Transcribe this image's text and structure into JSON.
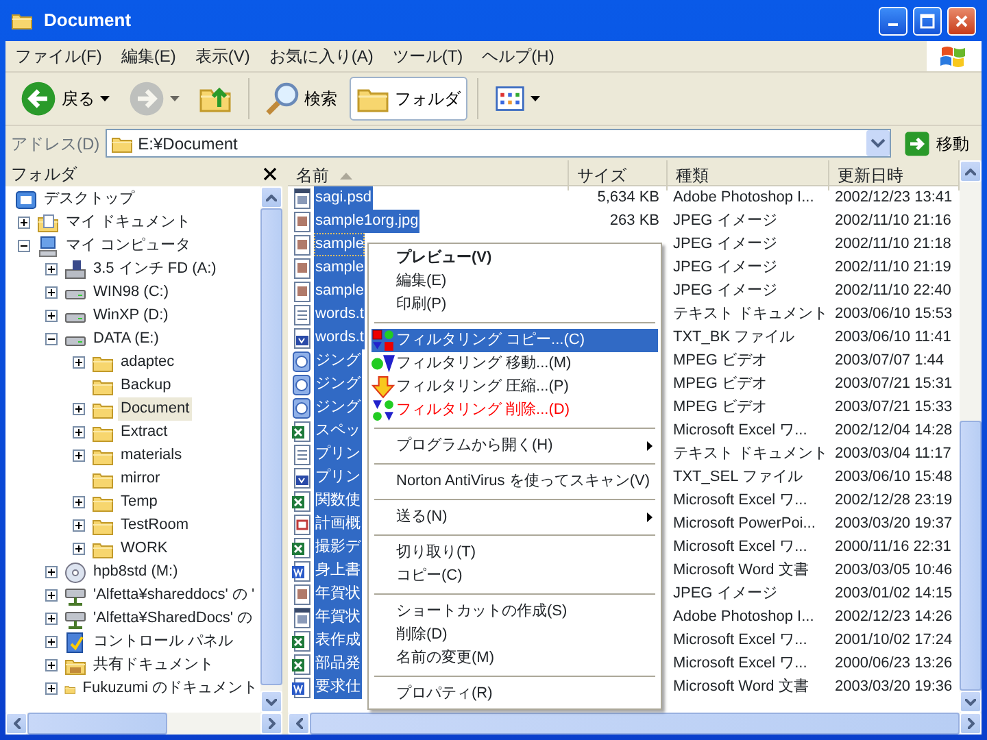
{
  "window": {
    "title": "Document"
  },
  "menu_bar": [
    "ファイル(F)",
    "編集(E)",
    "表示(V)",
    "お気に入り(A)",
    "ツール(T)",
    "ヘルプ(H)"
  ],
  "toolbar": [
    {
      "kind": "back",
      "label": "戻る",
      "disabled": false
    },
    {
      "kind": "forward",
      "disabled": true
    },
    {
      "kind": "up",
      "disabled": false
    },
    {
      "kind": "separator"
    },
    {
      "kind": "search",
      "label": "検索",
      "pressed": false
    },
    {
      "kind": "folders",
      "label": "フォルダ",
      "pressed": true
    },
    {
      "kind": "separator"
    },
    {
      "kind": "views"
    }
  ],
  "address_bar": {
    "label": "アドレス(D)",
    "value": "E:¥Document",
    "go_label": "移動"
  },
  "folder_pane": {
    "title": "フォルダ",
    "tree": [
      {
        "label": "デスクトップ",
        "kind": "desktop",
        "selected": false,
        "children": [
          {
            "label": "マイ ドキュメント",
            "kind": "mydocs",
            "expanded": false,
            "selected": false
          },
          {
            "label": "マイ コンピュータ",
            "kind": "computer",
            "expanded": true,
            "selected": false,
            "children": [
              {
                "label": "3.5 インチ FD (A:)",
                "kind": "floppy",
                "expanded": false,
                "selected": false
              },
              {
                "label": "WIN98 (C:)",
                "kind": "drive",
                "expanded": false,
                "selected": false
              },
              {
                "label": "WinXP (D:)",
                "kind": "drive",
                "expanded": false,
                "selected": false
              },
              {
                "label": "DATA (E:)",
                "kind": "drive",
                "expanded": true,
                "selected": false,
                "children": [
                  {
                    "label": "adaptec",
                    "kind": "folder",
                    "expanded": false,
                    "selected": false
                  },
                  {
                    "label": "Backup",
                    "kind": "folder",
                    "selected": false
                  },
                  {
                    "label": "Document",
                    "kind": "folder",
                    "expanded": false,
                    "selected": true
                  },
                  {
                    "label": "Extract",
                    "kind": "folder",
                    "expanded": false,
                    "selected": false
                  },
                  {
                    "label": "materials",
                    "kind": "folder",
                    "expanded": false,
                    "selected": false
                  },
                  {
                    "label": "mirror",
                    "kind": "folder",
                    "selected": false
                  },
                  {
                    "label": "Temp",
                    "kind": "folder",
                    "expanded": false,
                    "selected": false
                  },
                  {
                    "label": "TestRoom",
                    "kind": "folder",
                    "expanded": false,
                    "selected": false
                  },
                  {
                    "label": "WORK",
                    "kind": "folder",
                    "expanded": false,
                    "selected": false
                  }
                ]
              },
              {
                "label": "hpb8std (M:)",
                "kind": "cd",
                "expanded": false,
                "selected": false
              },
              {
                "label": "'Alfetta¥shareddocs' の '",
                "kind": "netdrive",
                "expanded": false,
                "selected": false
              },
              {
                "label": "'Alfetta¥SharedDocs' の",
                "kind": "netdrive",
                "expanded": false,
                "selected": false
              },
              {
                "label": "コントロール パネル",
                "kind": "control",
                "expanded": false,
                "selected": false
              },
              {
                "label": "共有ドキュメント",
                "kind": "shared",
                "expanded": false,
                "selected": false
              },
              {
                "label": "Fukuzumi のドキュメント",
                "kind": "folder",
                "expanded": false,
                "selected": false
              }
            ]
          }
        ]
      }
    ]
  },
  "file_list": {
    "columns": [
      {
        "label": "名前",
        "sorted": true
      },
      {
        "label": "サイズ",
        "sorted": false
      },
      {
        "label": "種類",
        "sorted": false
      },
      {
        "label": "更新日時",
        "sorted": false
      }
    ],
    "rows": [
      {
        "kind": "psd",
        "name": "sagi.psd",
        "size": "5,634 KB",
        "type": "Adobe Photoshop I...",
        "modified": "2002/12/23 13:41",
        "selected": true
      },
      {
        "kind": "jpg",
        "name": "sample1org.jpg",
        "size": "263 KB",
        "type": "JPEG イメージ",
        "modified": "2002/11/10 21:16",
        "selected": true
      },
      {
        "kind": "jpg",
        "name": "sample",
        "type": "JPEG イメージ",
        "modified": "2002/11/10 21:18",
        "selected": true,
        "focused": true
      },
      {
        "kind": "jpg",
        "name": "sample",
        "type": "JPEG イメージ",
        "modified": "2002/11/10 21:19",
        "selected": true
      },
      {
        "kind": "jpg",
        "name": "sample",
        "type": "JPEG イメージ",
        "modified": "2002/11/10 22:40",
        "selected": true
      },
      {
        "kind": "txt",
        "name": "words.t",
        "type": "テキスト ドキュメント",
        "modified": "2003/06/10 15:53",
        "selected": true
      },
      {
        "kind": "txt_bk",
        "name": "words.t",
        "type": "TXT_BK ファイル",
        "modified": "2003/06/10 11:41",
        "selected": true
      },
      {
        "kind": "mpeg",
        "name": "ジング",
        "type": "MPEG ビデオ",
        "modified": "2003/07/07 1:44",
        "selected": true
      },
      {
        "kind": "mpeg",
        "name": "ジング",
        "type": "MPEG ビデオ",
        "modified": "2003/07/21 15:31",
        "selected": true
      },
      {
        "kind": "mpeg",
        "name": "ジング",
        "type": "MPEG ビデオ",
        "modified": "2003/07/21 15:33",
        "selected": true
      },
      {
        "kind": "xls",
        "name": "スペッ",
        "type": "Microsoft Excel ワ...",
        "modified": "2002/12/04 14:28",
        "selected": true
      },
      {
        "kind": "txt",
        "name": "プリン",
        "type": "テキスト ドキュメント",
        "modified": "2003/03/04 11:17",
        "selected": true
      },
      {
        "kind": "txt_bk",
        "name": "プリン",
        "type": "TXT_SEL ファイル",
        "modified": "2003/06/10 15:48",
        "selected": true
      },
      {
        "kind": "xls",
        "name": "関数使",
        "type": "Microsoft Excel ワ...",
        "modified": "2002/12/28 23:19",
        "selected": true
      },
      {
        "kind": "ppt",
        "name": "計画概",
        "type": "Microsoft PowerPoi...",
        "modified": "2003/03/20 19:37",
        "selected": true
      },
      {
        "kind": "xls",
        "name": "撮影デ",
        "type": "Microsoft Excel ワ...",
        "modified": "2000/11/16 22:31",
        "selected": true
      },
      {
        "kind": "doc",
        "name": "身上書",
        "type": "Microsoft Word 文書",
        "modified": "2003/03/05 10:46",
        "selected": true
      },
      {
        "kind": "jpg",
        "name": "年賀状",
        "type": "JPEG イメージ",
        "modified": "2003/01/02 14:15",
        "selected": true
      },
      {
        "kind": "psd",
        "name": "年賀状",
        "type": "Adobe Photoshop I...",
        "modified": "2002/12/23 14:26",
        "selected": true
      },
      {
        "kind": "xls",
        "name": "表作成",
        "type": "Microsoft Excel ワ...",
        "modified": "2001/10/02 17:24",
        "selected": true
      },
      {
        "kind": "xls",
        "name": "部品発",
        "type": "Microsoft Excel ワ...",
        "modified": "2000/06/23 13:26",
        "selected": true
      },
      {
        "kind": "doc",
        "name": "要求仕",
        "type": "Microsoft Word 文書",
        "modified": "2003/03/20 19:36",
        "selected": true
      }
    ]
  },
  "context_menu": [
    {
      "kind": "item",
      "label": "プレビュー(V)",
      "default": true,
      "selected": false
    },
    {
      "kind": "item",
      "label": "編集(E)",
      "selected": false
    },
    {
      "kind": "item",
      "label": "印刷(P)",
      "selected": false
    },
    {
      "kind": "separator"
    },
    {
      "kind": "copy",
      "label": "フィルタリング コピー...(C)",
      "selected": true
    },
    {
      "kind": "move",
      "label": "フィルタリング 移動...(M)",
      "selected": false
    },
    {
      "kind": "compress",
      "label": "フィルタリング 圧縮...(P)",
      "selected": false
    },
    {
      "kind": "delete",
      "label": "フィルタリング 削除...(D)",
      "color": "#ff0000",
      "selected": false
    },
    {
      "kind": "separator"
    },
    {
      "kind": "item",
      "label": "プログラムから開く(H)",
      "submenu": true,
      "selected": false
    },
    {
      "kind": "separator"
    },
    {
      "kind": "item",
      "label": "Norton AntiVirus を使ってスキャン(V)",
      "selected": false
    },
    {
      "kind": "separator"
    },
    {
      "kind": "item",
      "label": "送る(N)",
      "submenu": true,
      "selected": false
    },
    {
      "kind": "separator"
    },
    {
      "kind": "item",
      "label": "切り取り(T)",
      "selected": false
    },
    {
      "kind": "item",
      "label": "コピー(C)",
      "selected": false
    },
    {
      "kind": "separator"
    },
    {
      "kind": "item",
      "label": "ショートカットの作成(S)",
      "selected": false
    },
    {
      "kind": "item",
      "label": "削除(D)",
      "selected": false
    },
    {
      "kind": "item",
      "label": "名前の変更(M)",
      "selected": false
    },
    {
      "kind": "separator"
    },
    {
      "kind": "item",
      "label": "プロパティ(R)",
      "selected": false
    }
  ]
}
